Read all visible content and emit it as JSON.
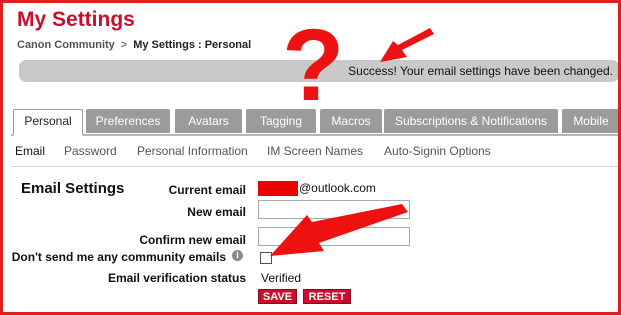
{
  "header": {
    "title": "My Settings",
    "breadcrumb": {
      "root": "Canon Community",
      "separator": ">",
      "current": "My Settings : Personal"
    },
    "success_message": "Success! Your email settings have been changed."
  },
  "tabs": [
    {
      "label": "Personal",
      "active": true
    },
    {
      "label": "Preferences"
    },
    {
      "label": "Avatars"
    },
    {
      "label": "Tagging"
    },
    {
      "label": "Macros"
    },
    {
      "label": "Subscriptions & Notifications"
    },
    {
      "label": "Mobile"
    }
  ],
  "subtabs": [
    {
      "label": "Email",
      "active": true
    },
    {
      "label": "Password"
    },
    {
      "label": "Personal Information"
    },
    {
      "label": "IM Screen Names"
    },
    {
      "label": "Auto-Signin Options"
    }
  ],
  "email_settings": {
    "section_title": "Email Settings",
    "current_email_label": "Current email",
    "current_email_domain": "@outlook.com",
    "new_email_label": "New email",
    "new_email_value": "",
    "confirm_email_label": "Confirm new email",
    "confirm_email_value": "",
    "no_emails_label": "Don't send me any community emails",
    "no_emails_checked": false,
    "info_icon": "info-icon",
    "verification_label": "Email verification status",
    "verification_value": "Verified",
    "save_label": "SAVE",
    "reset_label": "RESET"
  },
  "annotations": {
    "question_mark": "?",
    "color": "#ee1111"
  },
  "colors": {
    "brand_red": "#c8102e",
    "tab_gray": "#9b9b9b",
    "success_bar": "#c9c9c9"
  }
}
